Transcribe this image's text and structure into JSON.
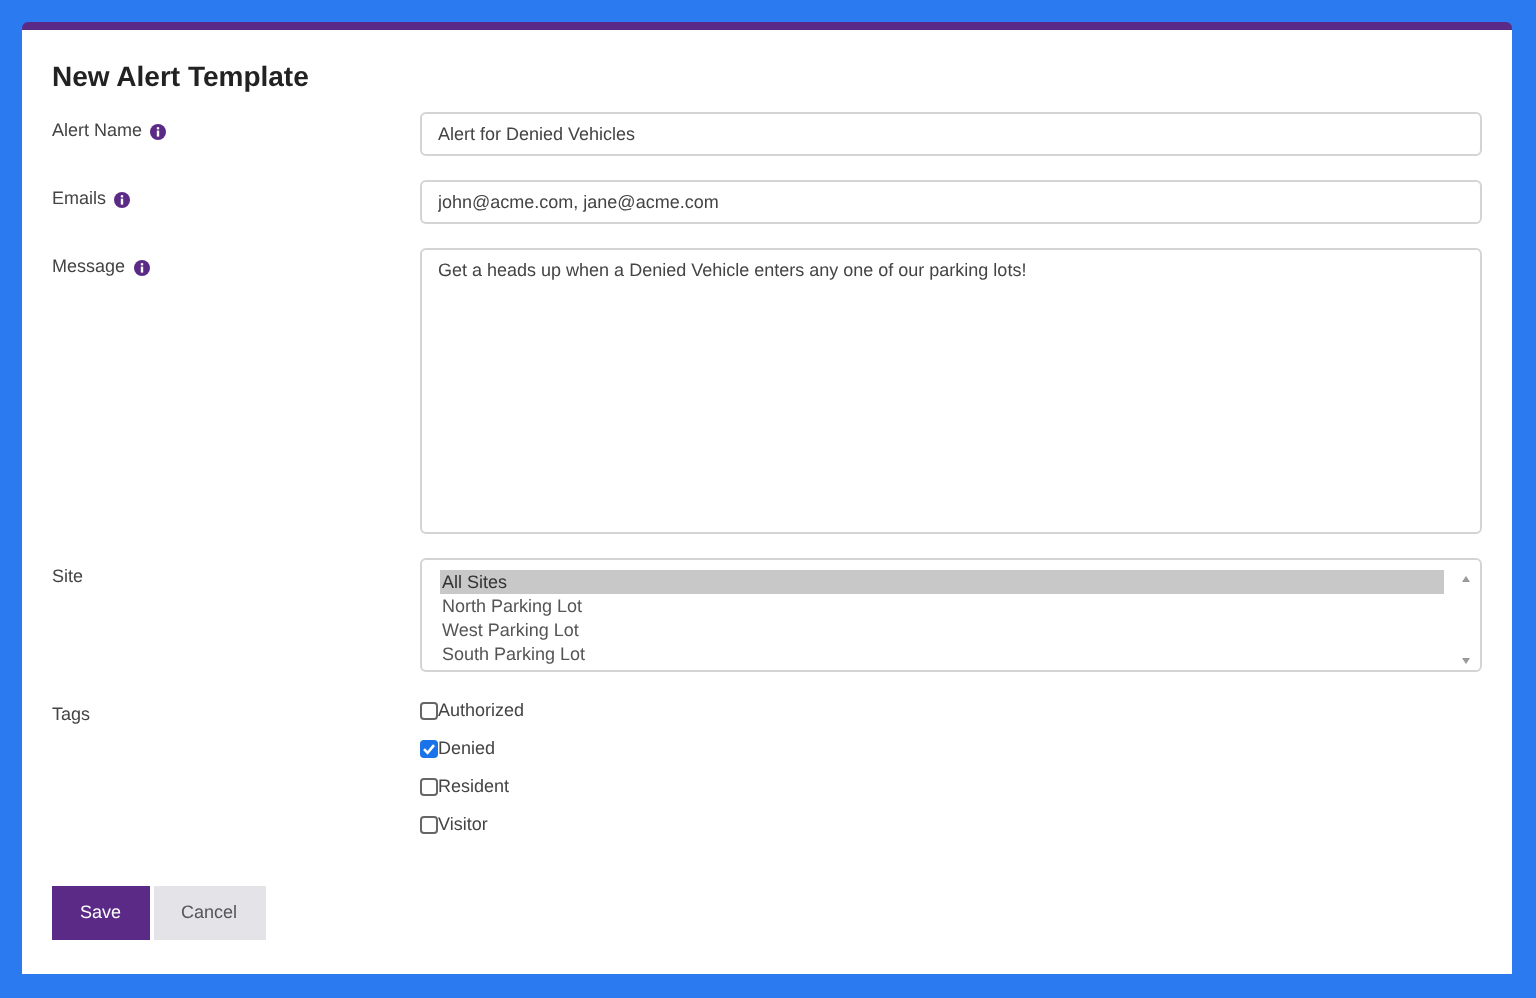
{
  "title": "New Alert Template",
  "fields": [
    {
      "kind": "input",
      "label": "Alert Name",
      "info": true,
      "value": "Alert for Denied Vehicles"
    },
    {
      "kind": "input",
      "label": "Emails",
      "info": true,
      "value": "john@acme.com, jane@acme.com"
    },
    {
      "kind": "textarea",
      "label": "Message",
      "info": true,
      "value": "Get a heads up when a Denied Vehicle enters any one of our parking lots!"
    },
    {
      "kind": "select",
      "label": "Site",
      "info": false,
      "options": [
        {
          "label": "All Sites",
          "selected": true
        },
        {
          "label": "North Parking Lot",
          "selected": false
        },
        {
          "label": "West Parking Lot",
          "selected": false
        },
        {
          "label": "South Parking Lot",
          "selected": false
        }
      ]
    },
    {
      "kind": "checkboxes",
      "label": "Tags",
      "info": false,
      "options": [
        {
          "label": "Authorized",
          "checked": false
        },
        {
          "label": "Denied",
          "checked": true
        },
        {
          "label": "Resident",
          "checked": false
        },
        {
          "label": "Visitor",
          "checked": false
        }
      ]
    }
  ],
  "buttons": [
    {
      "label": "Save",
      "kind": "primary"
    },
    {
      "label": "Cancel",
      "kind": "secondary"
    }
  ]
}
